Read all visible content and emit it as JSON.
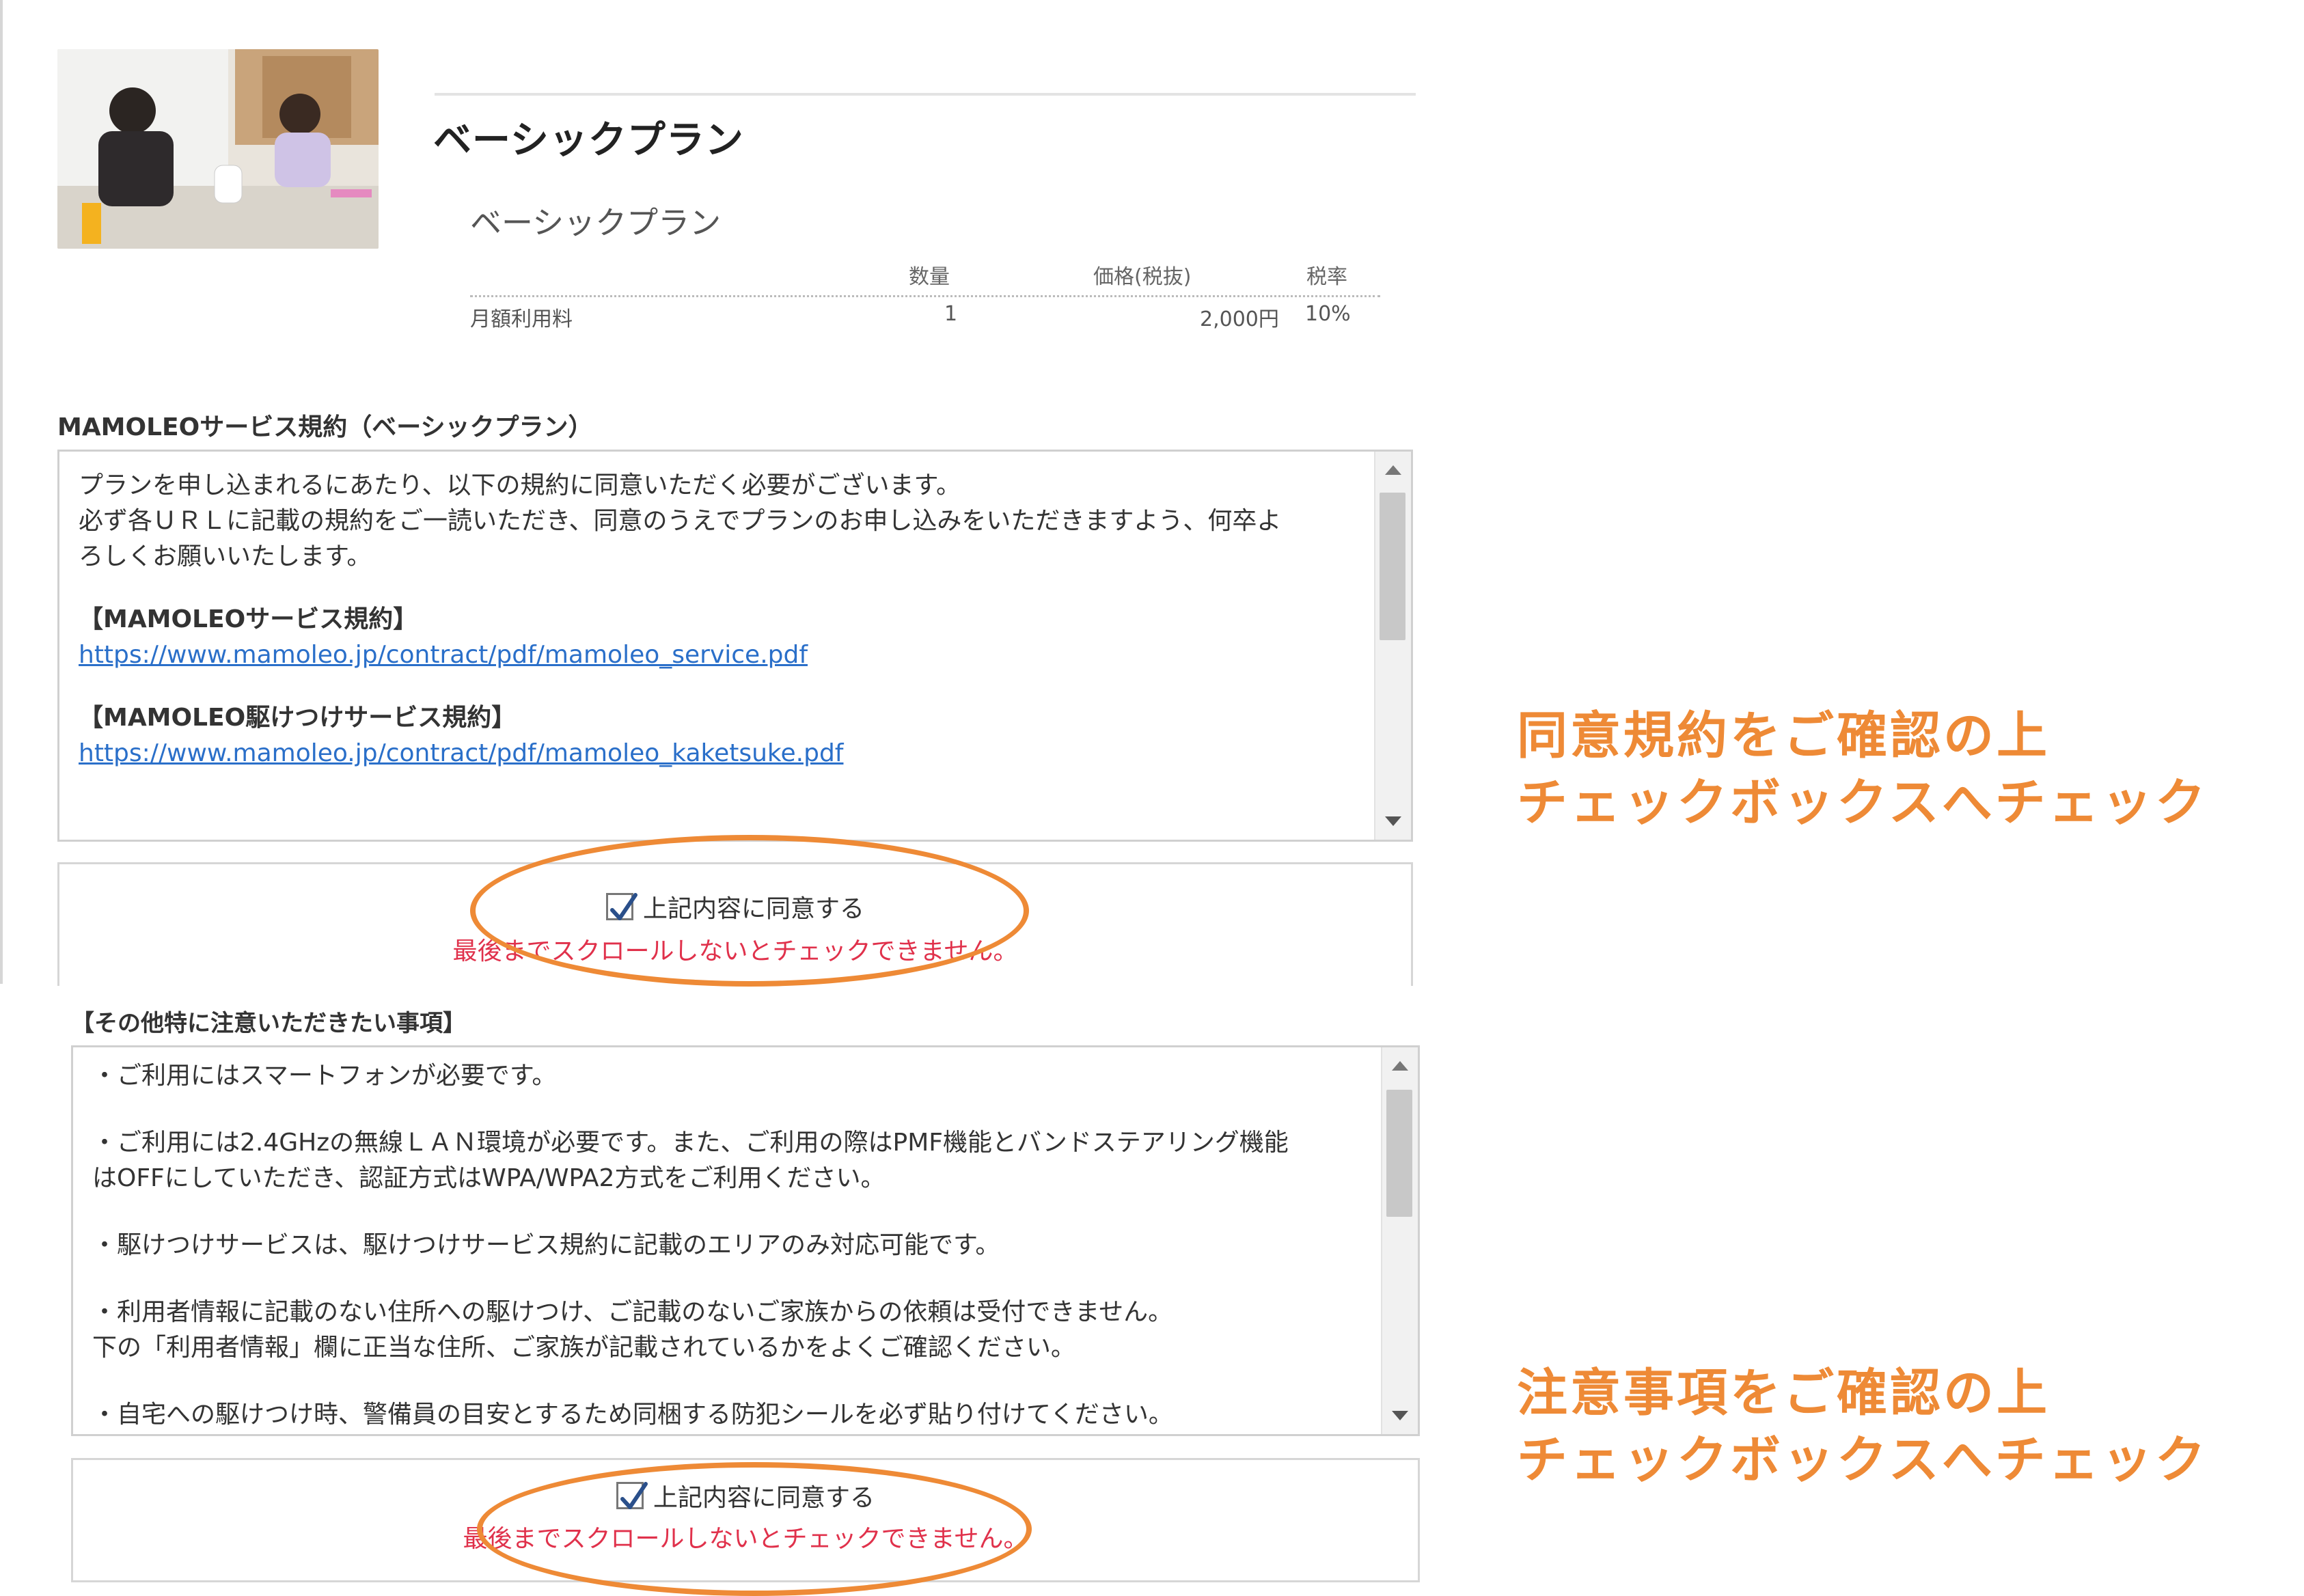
{
  "plan": {
    "title": "ベーシックプラン",
    "subtitle": "ベーシックプラン",
    "table": {
      "headers": {
        "quantity": "数量",
        "price": "価格(税抜)",
        "tax_rate": "税率"
      },
      "rows": [
        {
          "name": "月額利用料",
          "quantity": "1",
          "price": "2,000円",
          "tax_rate": "10%"
        }
      ]
    }
  },
  "terms": {
    "title": "MAMOLEOサービス規約（ベーシックプラン）",
    "intro_lines": [
      "プランを申し込まれるにあたり、以下の規約に同意いただく必要がございます。",
      "必ず各ＵＲＬに記載の規約をご一読いただき、同意のうえでプランのお申し込みをいただきますよう、何卒よ",
      "ろしくお願いいたします。"
    ],
    "items": [
      {
        "heading": "【MAMOLEOサービス規約】",
        "url": "https://www.mamoleo.jp/contract/pdf/mamoleo_service.pdf"
      },
      {
        "heading": "【MAMOLEO駆けつけサービス規約】",
        "url": "https://www.mamoleo.jp/contract/pdf/mamoleo_kaketsuke.pdf"
      }
    ],
    "agree_label": "上記内容に同意する",
    "agree_note": "最後までスクロールしないとチェックできません。",
    "agreed": true
  },
  "notices": {
    "title": "【その他特に注意いただきたい事項】",
    "paragraphs": [
      [
        "・ご利用にはスマートフォンが必要です。"
      ],
      [
        "・ご利用には2.4GHzの無線ＬＡＮ環境が必要です。また、ご利用の際はPMF機能とバンドステアリング機能",
        "はOFFにしていただき、認証方式はWPA/WPA2方式をご利用ください。"
      ],
      [
        "・駆けつけサービスは、駆けつけサービス規約に記載のエリアのみ対応可能です。"
      ],
      [
        "・利用者情報に記載のない住所への駆けつけ、ご記載のないご家族からの依頼は受付できません。",
        "下の「利用者情報」欄に正当な住所、ご家族が記載されているかをよくご確認ください。"
      ],
      [
        "・自宅への駆けつけ時、警備員の目安とするため同梱する防犯シールを必ず貼り付けてください。"
      ]
    ],
    "agree_label": "上記内容に同意する",
    "agree_note": "最後までスクロールしないとチェックできません。",
    "agreed": true
  },
  "annotations": {
    "terms": {
      "line1": "同意規約をご確認の上",
      "line2": "チェックボックスへチェック"
    },
    "notices": {
      "line1": "注意事項をご確認の上",
      "line2": "チェックボックスへチェック"
    }
  },
  "colors": {
    "accent": "#ee8a36",
    "warning": "#e0314b",
    "link": "#2a6fc9"
  },
  "icons": {
    "check": "check-icon",
    "scroll_up": "arrow-up-icon",
    "scroll_down": "arrow-down-icon"
  }
}
